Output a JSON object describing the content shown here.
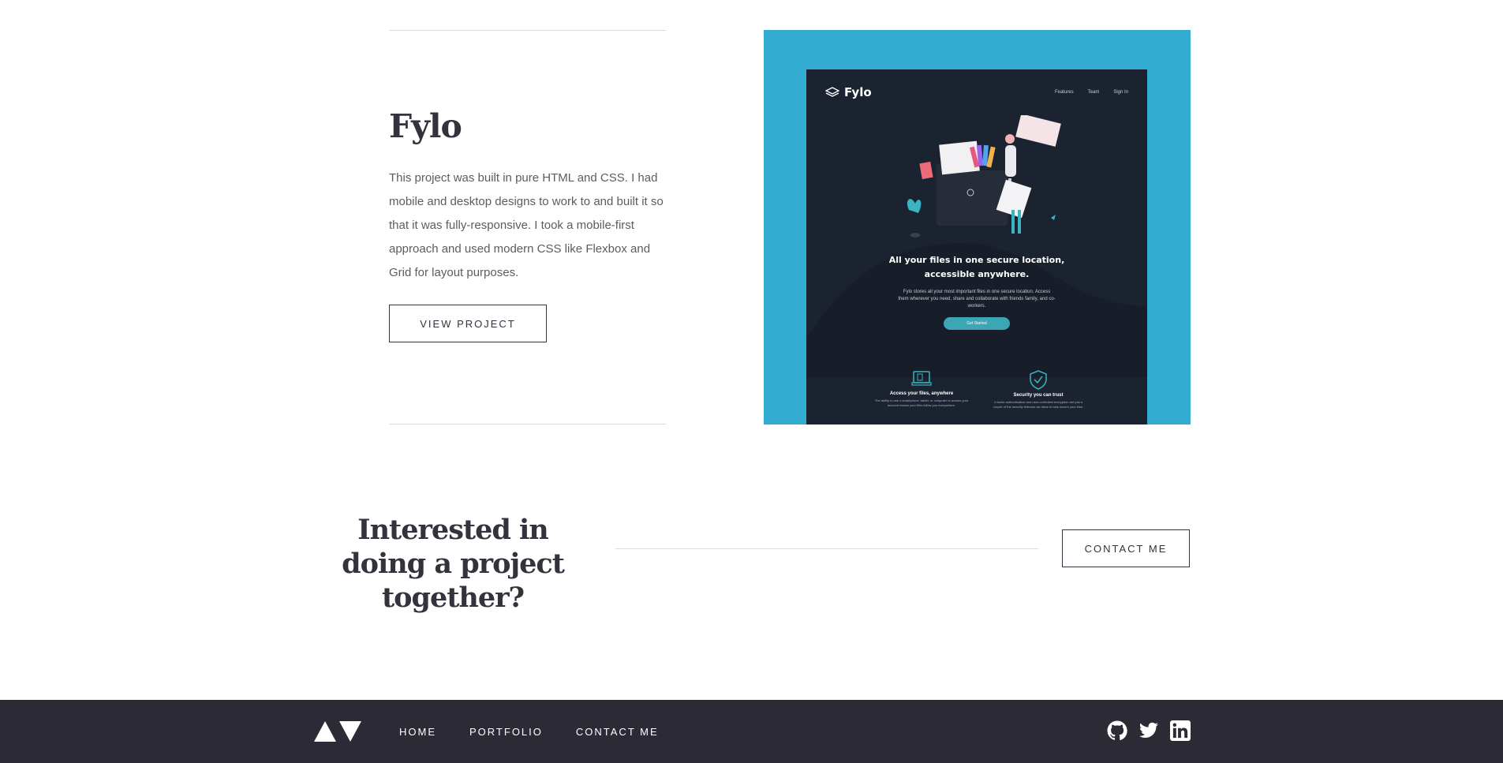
{
  "project": {
    "title": "Fylo",
    "description": "This project was built in pure HTML and CSS. I had mobile and desktop designs to work to and built it so that it was fully-responsive. I took a mobile-first approach and used modern CSS like Flexbox and Grid for layout purposes.",
    "button_label": "VIEW PROJECT"
  },
  "preview": {
    "brand": "Fylo",
    "nav": [
      "Features",
      "Team",
      "Sign In"
    ],
    "hero_line1": "All your files in one secure location,",
    "hero_line2": "accessible anywhere.",
    "sub": "Fylo stores all your most important files in one secure location. Access them wherever you need, share and collaborate with friends family, and co-workers.",
    "cta": "Get Started",
    "features": [
      {
        "title": "Access your files, anywhere",
        "desc": "The ability to use a smartphone, tablet, or computer to access your account means your files follow you everywhere."
      },
      {
        "title": "Security you can trust",
        "desc": "2-factor authentication and user-controlled encryption are just a couple of the security features we allow to help secure your files."
      }
    ],
    "colors": {
      "frame": "#33acd1",
      "screen": "#1c2330",
      "accent": "#3ca6b4"
    }
  },
  "cta": {
    "heading": "Interested in doing a project together?",
    "button_label": "CONTACT ME"
  },
  "footer": {
    "nav": [
      "HOME",
      "PORTFOLIO",
      "CONTACT ME"
    ],
    "socials": [
      "github-icon",
      "twitter-icon",
      "linkedin-icon"
    ],
    "background": "#2c2b35"
  }
}
